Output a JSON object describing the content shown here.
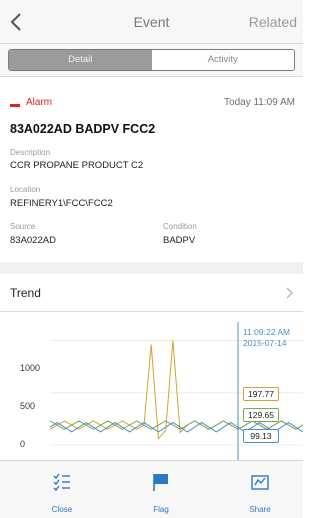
{
  "nav": {
    "back_icon": "chevron-left-icon",
    "title": "Event",
    "related": "Related"
  },
  "segments": {
    "detail": "Detail",
    "activity": "Activity",
    "selected": "Detail"
  },
  "event": {
    "severity": "Alarm",
    "severity_color": "#e0231c",
    "time": "Today 11:09 AM",
    "title": "83A022AD BADPV  FCC2",
    "description_label": "Description",
    "description": "CCR PROPANE PRODUCT C2",
    "location_label": "Location",
    "location": "REFINERY1\\FCC\\FCC2",
    "source_label": "Source",
    "source": "83A022AD",
    "condition_label": "Condition",
    "condition": "BADPV"
  },
  "trend": {
    "label": "Trend",
    "chevron_icon": "chevron-right-icon"
  },
  "chart_data": {
    "type": "line",
    "y_ticks": [
      "1000",
      "500",
      "0"
    ],
    "ylim": [
      0,
      1100
    ],
    "cursor_time": "11:09:22 AM",
    "cursor_date": "2015-07-14",
    "series": [
      {
        "color": "#d4a52a",
        "cursor_value": "197.77",
        "values": [
          150,
          190,
          230,
          190,
          150,
          190,
          230,
          190,
          150,
          190,
          230,
          190,
          150,
          190,
          960,
          60,
          140,
          1000,
          120,
          190,
          230,
          190,
          150,
          190,
          230,
          190,
          150,
          190,
          230,
          190,
          150,
          190,
          230,
          190,
          150,
          190
        ]
      },
      {
        "color": "#78a85a",
        "cursor_value": "129.65",
        "values": [
          230,
          190,
          150,
          190,
          230,
          190,
          150,
          190,
          230,
          190,
          150,
          190,
          230,
          190,
          150,
          190,
          230,
          190,
          150,
          190,
          230,
          190,
          150,
          190,
          230,
          190,
          150,
          190,
          230,
          190,
          150,
          190,
          230,
          190,
          150,
          190
        ]
      },
      {
        "color": "#4a90c8",
        "cursor_value": "99.13",
        "values": [
          170,
          215,
          170,
          125,
          170,
          215,
          170,
          125,
          170,
          215,
          170,
          125,
          170,
          215,
          170,
          125,
          170,
          215,
          170,
          125,
          170,
          215,
          170,
          125,
          170,
          215,
          170,
          125,
          170,
          215,
          170,
          125,
          170,
          215,
          170,
          125
        ]
      }
    ]
  },
  "tabbar": {
    "close": {
      "label": "Close",
      "icon": "checklist-icon"
    },
    "flag": {
      "label": "Flag",
      "icon": "flag-icon"
    },
    "share": {
      "label": "Share",
      "icon": "share-icon"
    }
  }
}
